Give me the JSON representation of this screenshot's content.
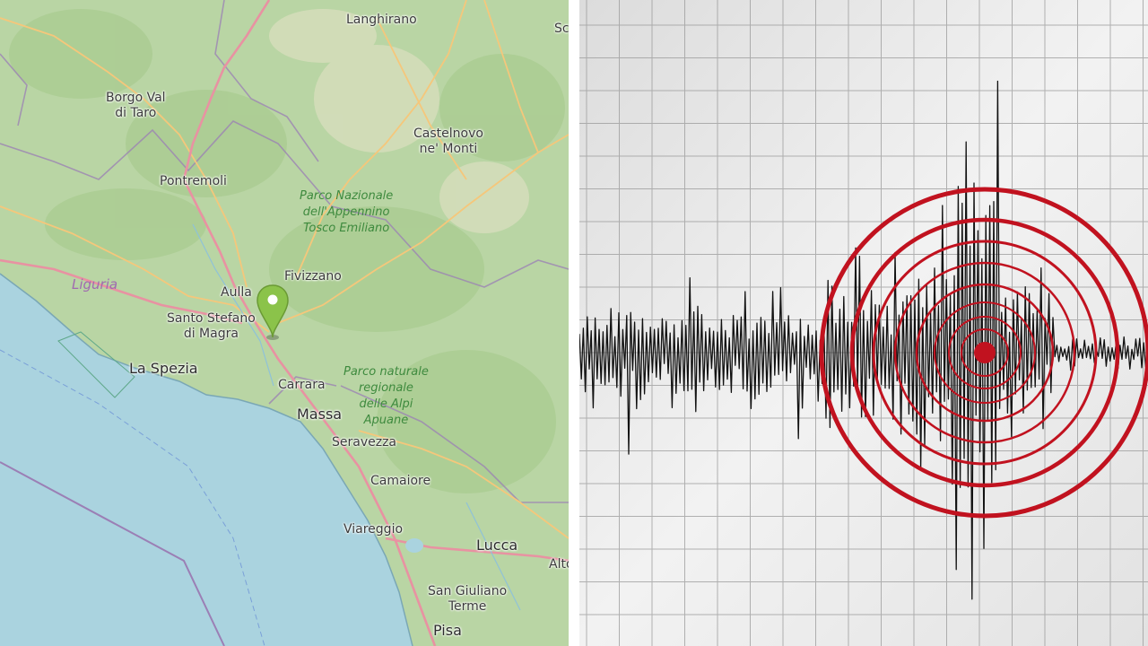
{
  "map": {
    "places": {
      "langhirano": "Langhirano",
      "sc": "Sc",
      "borgo": "Borgo Val\ndi Taro",
      "castelnovo": "Castelnovo\nne' Monti",
      "pontremoli": "Pontremoli",
      "fivizzano": "Fivizzano",
      "aulla": "Aulla",
      "santo_stefano": "Santo Stefano\ndi Magra",
      "la_spezia": "La Spezia",
      "carrara": "Carrara",
      "massa": "Massa",
      "seravezza": "Seravezza",
      "camaiore": "Camaiore",
      "viareggio": "Viareggio",
      "lucca": "Lucca",
      "alto": "Alto",
      "san_giuliano": "San Giuliano\nTerme",
      "pisa": "Pisa"
    },
    "parks": {
      "appennino": "Parco Nazionale\ndell'Appennino\nTosco Emiliano",
      "apuane": "Parco naturale\nregionale\ndelle Alpi\nApuane"
    },
    "region": "Liguria",
    "marker_icon": "map-pin-icon",
    "colors": {
      "land": "#b9d5a4",
      "sea": "#aad3df",
      "marker": "#8bc34a",
      "major_road": "#e892a2",
      "secondary_road": "#f9d58e",
      "border": "#9b7fb5"
    }
  },
  "seismogram": {
    "icon": "earthquake-epicenter-icon",
    "colors": {
      "paper": "#ececec",
      "grid": "#9a9a9a",
      "trace": "#111111",
      "rings": "#c1121f"
    }
  }
}
